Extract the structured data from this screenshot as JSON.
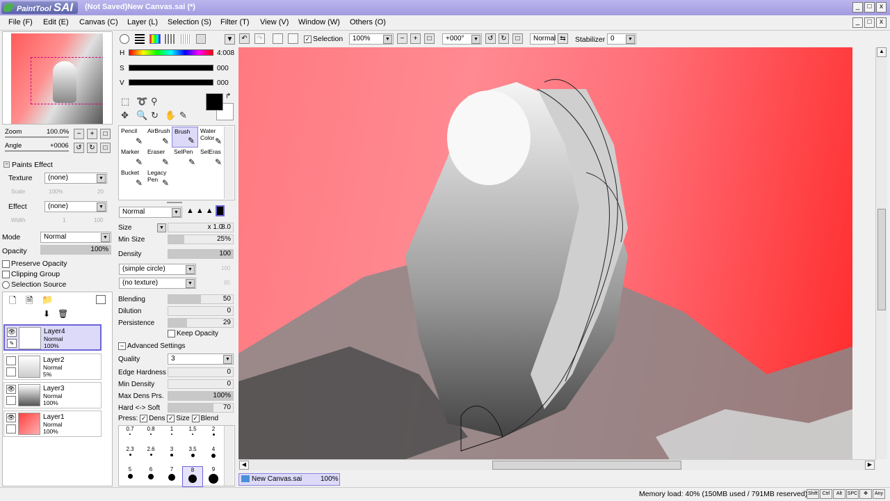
{
  "app": {
    "logo_text_small": "PaintTool",
    "logo_text_big": "SAI",
    "window_title": "(Not Saved)New Canvas.sai (*)",
    "win_min": "_",
    "win_max": "□",
    "win_close": "x"
  },
  "menu": [
    "File (F)",
    "Edit (E)",
    "Canvas (C)",
    "Layer (L)",
    "Selection (S)",
    "Filter (T)",
    "View (V)",
    "Window (W)",
    "Others (O)"
  ],
  "navigator": {
    "zoom_label": "Zoom",
    "zoom_value": "100.0%",
    "angle_label": "Angle",
    "angle_value": "+0006"
  },
  "paints_effect": {
    "header": "Paints Effect",
    "texture_label": "Texture",
    "texture_value": "(none)",
    "scale_label": "Scale",
    "scale_value": "100%",
    "scale_num": "20",
    "effect_label": "Effect",
    "effect_value": "(none)",
    "width_label": "Width",
    "width_value": "1",
    "width_num": "100"
  },
  "layer_props": {
    "mode_label": "Mode",
    "mode_value": "Normal",
    "opacity_label": "Opacity",
    "opacity_value": "100%",
    "preserve_opacity": "Preserve Opacity",
    "clipping_group": "Clipping Group",
    "selection_source": "Selection Source"
  },
  "layers": [
    {
      "name": "Layer4",
      "mode": "Normal",
      "opacity": "100%",
      "visible": true,
      "selected": true
    },
    {
      "name": "Layer2",
      "mode": "Normal",
      "opacity": "5%",
      "visible": false,
      "selected": false
    },
    {
      "name": "Layer3",
      "mode": "Normal",
      "opacity": "100%",
      "visible": true,
      "selected": false
    },
    {
      "name": "Layer1",
      "mode": "Normal",
      "opacity": "100%",
      "visible": true,
      "selected": false
    }
  ],
  "color": {
    "h_label": "H",
    "h_value": "4:008",
    "s_label": "S",
    "s_value": "000",
    "v_label": "V",
    "v_value": "000",
    "primary": "#000000",
    "secondary": "#ffffff"
  },
  "tools": [
    {
      "name": "Pencil",
      "icon": "pencil-icon"
    },
    {
      "name": "AirBrush",
      "icon": "airbrush-icon"
    },
    {
      "name": "Brush",
      "icon": "brush-icon"
    },
    {
      "name": "Water Color",
      "icon": "watercolor-icon"
    },
    {
      "name": "Marker",
      "icon": "marker-icon"
    },
    {
      "name": "Eraser",
      "icon": "eraser-icon"
    },
    {
      "name": "SelPen",
      "icon": "selpen-icon"
    },
    {
      "name": "SelEras",
      "icon": "seleras-icon"
    },
    {
      "name": "Bucket",
      "icon": "bucket-icon"
    },
    {
      "name": "Legacy Pen",
      "icon": "legacy-pen-icon"
    }
  ],
  "brush": {
    "blend_mode": "Normal",
    "size_label": "Size",
    "size_mult": "x 1.0",
    "size_value": "8.0",
    "min_size_label": "Min Size",
    "min_size_value": "25%",
    "min_size_fill": 0.25,
    "density_label": "Density",
    "density_value": "100",
    "density_fill": 1.0,
    "shape_value": "(simple circle)",
    "shape_num": "100",
    "texture_value": "(no texture)",
    "texture_num": "95",
    "blending_label": "Blending",
    "blending_value": "50",
    "blending_fill": 0.5,
    "dilution_label": "Dilution",
    "dilution_value": "0",
    "persistence_label": "Persistence",
    "persistence_value": "29",
    "persistence_fill": 0.29,
    "keep_opacity": "Keep Opacity",
    "advanced": "Advanced Settings",
    "quality_label": "Quality",
    "quality_value": "3",
    "edge_hardness_label": "Edge Hardness",
    "edge_hardness_value": "0",
    "min_density_label": "Min Density",
    "min_density_value": "0",
    "max_dens_label": "Max Dens Prs.",
    "max_dens_value": "100%",
    "max_dens_fill": 1.0,
    "hard_soft_label": "Hard <-> Soft",
    "hard_soft_value": "70",
    "hard_soft_fill": 0.7,
    "press_label": "Press:",
    "press_dens": "Dens",
    "press_size": "Size",
    "press_blend": "Blend"
  },
  "brush_sizes": [
    "0.7",
    "0.8",
    "1",
    "1.5",
    "2",
    "2.3",
    "2.6",
    "3",
    "3.5",
    "4",
    "5",
    "6",
    "7",
    "8",
    "9"
  ],
  "toolbar": {
    "selection_label": "Selection",
    "zoom_value": "100%",
    "rotation_value": "+000°",
    "blend_value": "Normal",
    "stabilizer_label": "Stabilizer",
    "stabilizer_value": "0"
  },
  "canvas_tab": {
    "name": "New Canvas.sai",
    "zoom": "100%"
  },
  "status": {
    "memory": "Memory load: 40% (150MB used / 791MB reserved)",
    "keys": [
      "Shift",
      "Ctrl",
      "Alt",
      "SPC",
      "✥",
      "Any"
    ]
  }
}
